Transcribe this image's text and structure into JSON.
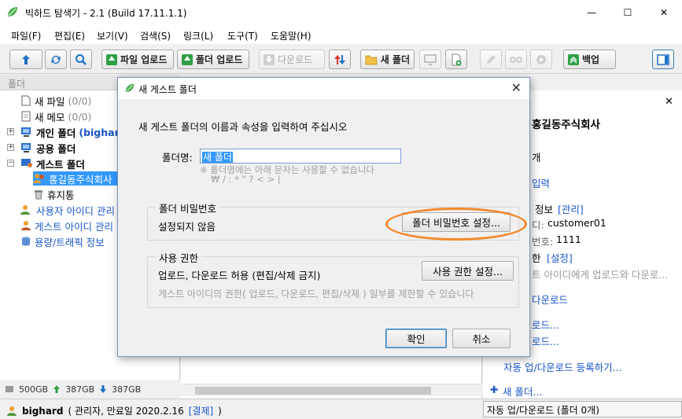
{
  "window": {
    "title": "빅하드 탐색기 - 2.1 (Build 17.11.1.1)",
    "controls": {
      "minimize": "—",
      "maximize": "☐",
      "close": "✕"
    }
  },
  "menu": [
    "파일(F)",
    "편집(E)",
    "보기(V)",
    "검색(S)",
    "링크(L)",
    "도구(T)",
    "도움말(H)"
  ],
  "toolbar": {
    "upload": "파일 업로드",
    "folder_upload": "폴더 업로드",
    "download": "다운로드",
    "new_folder": "새 폴더",
    "backup": "백업"
  },
  "left_header": "폴더",
  "tree": {
    "new_file": "새 파일",
    "new_file_count": "(0/0)",
    "new_memo": "새 메모",
    "new_memo_count": "(0/0)",
    "personal_folder": "개인 폴더",
    "personal_owner": "(bighar",
    "shared_folder": "공용 폴더",
    "guest_folder": "게스트 폴더",
    "guest_company": "홍길동주식회사",
    "trash": "휴지통",
    "user_id_mgmt": "사용자 아이디 관리",
    "guest_id_mgmt": "게스트 아이디 관리",
    "traffic_info": "용량/트래픽 정보"
  },
  "left_status": {
    "total": "500GB",
    "up": "387GB",
    "down": "387GB"
  },
  "right_pane": {
    "company": "홍길동주식회사",
    "count": "개",
    "input": "입력",
    "info_label": "정보",
    "info_link": "[관리]",
    "id_label": "디:",
    "id_value": "customer01",
    "pw_label": "번호:",
    "pw_value": "1111",
    "perm_label": "한",
    "perm_link": "[설정]",
    "perm_desc": "트 아이디에게 업로드와 다운로...",
    "download_link": "다운로드",
    "upload_link1": "로드...",
    "upload_link2": "로드...",
    "auto_register": "자동 업/다운로드 등록하기...",
    "new_folder": "새 폴더..."
  },
  "statusbar": {
    "user": "bighard",
    "role": "( 관리자, 만료일 2020.2.16",
    "pay": "[결제]",
    "close_paren": ")",
    "auto_status": "자동 업/다운로드 (폴더 0개)"
  },
  "dialog": {
    "title": "새 게스트 폴더",
    "close": "✕",
    "intro": "새 게스트 폴더의 이름과 속성을 입력하여 주십시오",
    "name_label": "폴더명:",
    "name_value": "새 폴더",
    "hint1": "※ 폴더명에는 아래 문자는 사용할 수 없습니다",
    "hint2": "₩ / : * \" ? < > |",
    "password_group": "폴더 비밀번호",
    "password_status": "설정되지 않음",
    "password_button": "폴더 비밀번호 설정...",
    "permission_group": "사용 권한",
    "permission_value": "업로드, 다운로드 허용 (편집/삭제 금지)",
    "permission_button": "사용 권한 설정...",
    "permission_hint": "게스트 아이디의 권한( 업로드, 다운로드, 편집/삭제 ) 일부를 제한할 수 있습니다",
    "ok": "확인",
    "cancel": "취소"
  },
  "colors": {
    "accent": "#3399ff",
    "link": "#1a55c9",
    "brand_green": "#2e9f46",
    "highlight": "#f28a2e"
  }
}
